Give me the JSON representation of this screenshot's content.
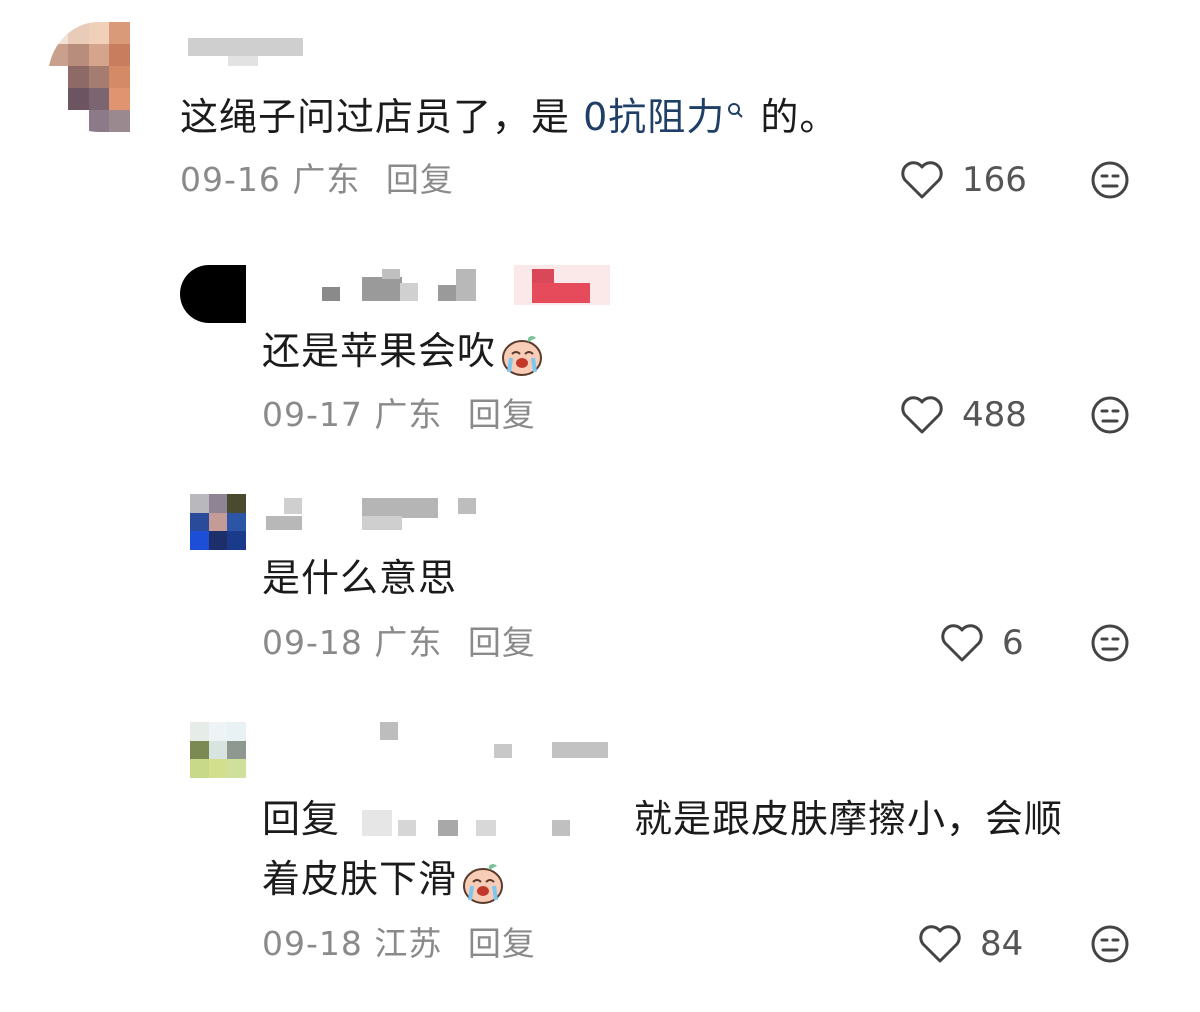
{
  "comments": [
    {
      "text_before": "这绳子问过店员了，是 ",
      "link": "0抗阻力",
      "text_after": " 的。",
      "date": "09-16",
      "location": "广东",
      "reply_label": "回复",
      "likes": "166"
    },
    {
      "text": "还是苹果会吹",
      "date": "09-17",
      "location": "广东",
      "reply_label": "回复",
      "likes": "488"
    },
    {
      "text": "是什么意思",
      "date": "09-18",
      "location": "广东",
      "reply_label": "回复",
      "likes": "6"
    },
    {
      "reply_prefix": "回复",
      "text_line1": "就是跟皮肤摩擦小，会顺",
      "text_line2": "着皮肤下滑",
      "date": "09-18",
      "location": "江苏",
      "reply_label": "回复",
      "likes": "84"
    }
  ],
  "icons": {
    "like": "heart-outline-icon",
    "dislike": "neutral-face-icon",
    "link_search": "search-icon",
    "emoji": "crying-laughing-emoji-icon"
  },
  "colors": {
    "link": "#1f3f67",
    "meta": "#8a8a8a",
    "text": "#1b1b1b"
  }
}
